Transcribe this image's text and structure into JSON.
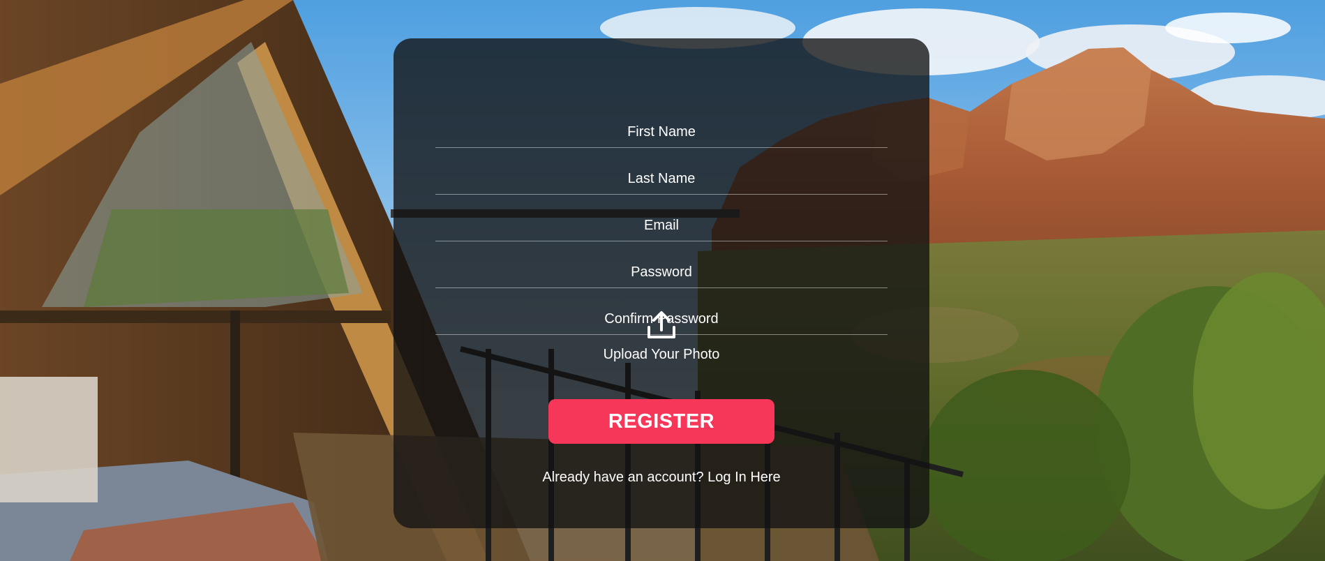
{
  "form": {
    "first_name_placeholder": "First Name",
    "last_name_placeholder": "Last Name",
    "email_placeholder": "Email",
    "password_placeholder": "Password",
    "confirm_password_placeholder": "Confirm Password",
    "upload_label": "Upload Your Photo",
    "upload_icon": "upload-icon",
    "register_label": "REGISTER",
    "login_prompt": "Already have an account?",
    "login_link": "Log In Here"
  },
  "colors": {
    "accent": "#f7375a",
    "card_background": "rgba(18,18,18,0.78)",
    "text": "#ffffff"
  }
}
